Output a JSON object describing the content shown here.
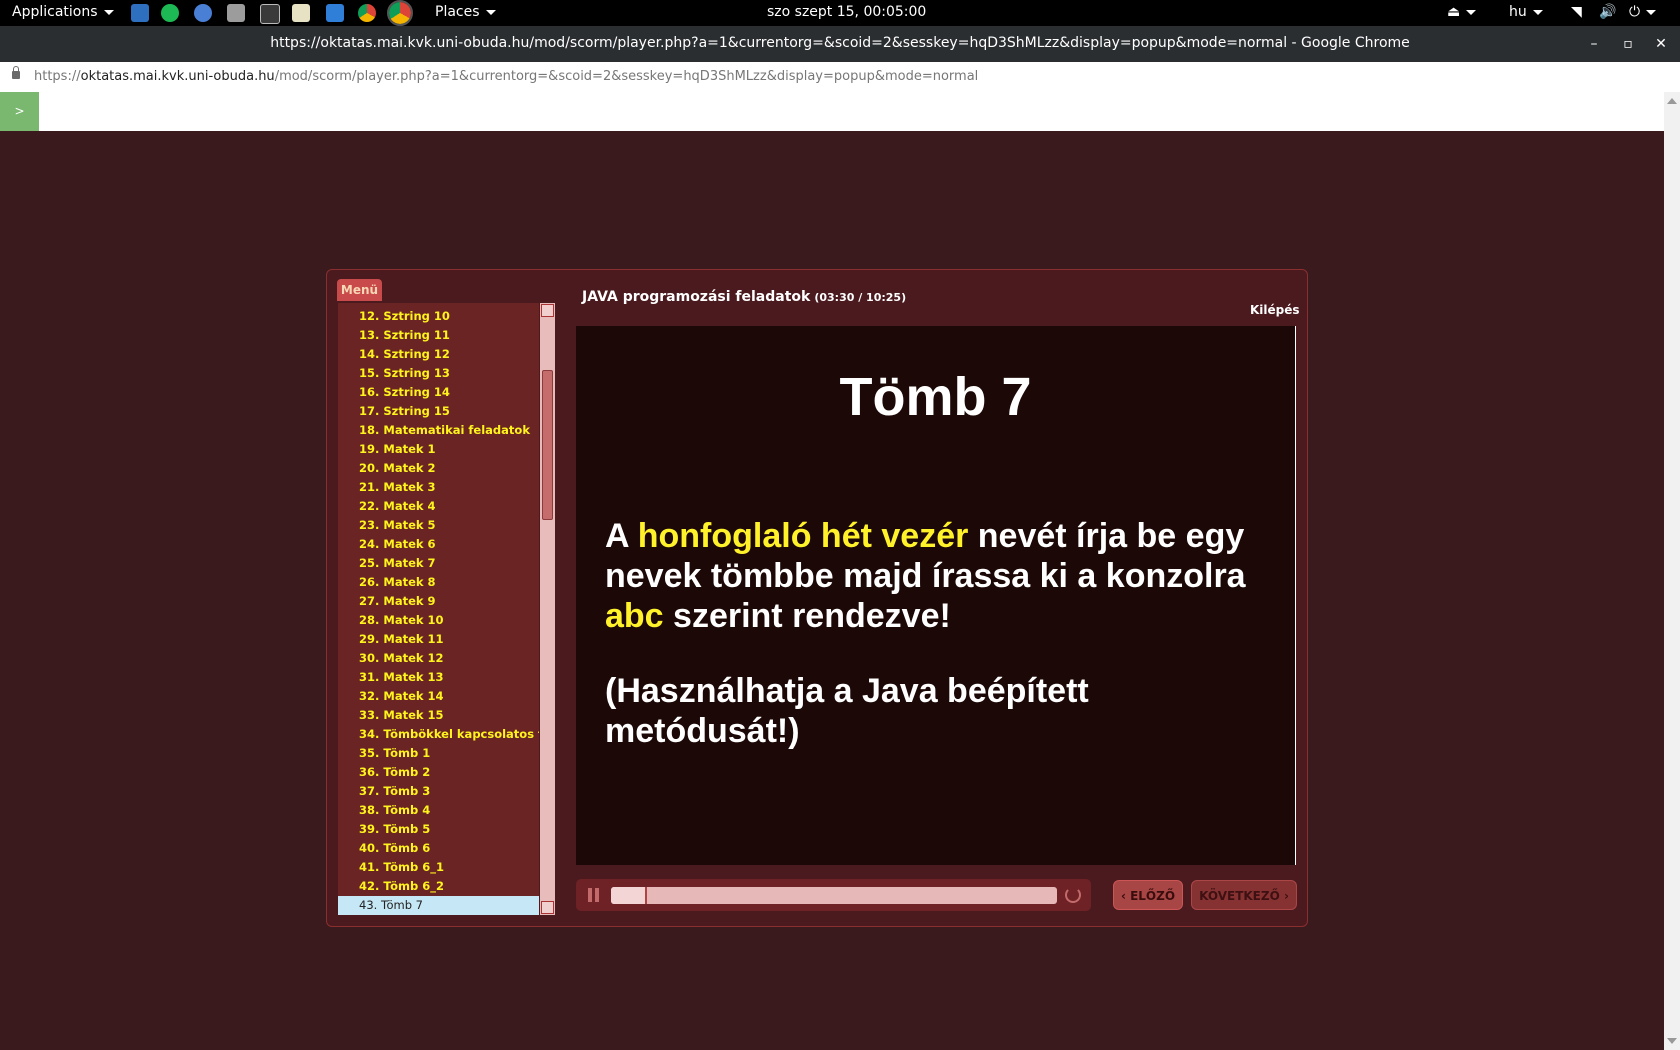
{
  "top_panel": {
    "applications": "Applications",
    "places": "Places",
    "clock": "szo szept 15, 00:05:00",
    "keyboard_layout": "hu",
    "launcher_icons": [
      "files-icon",
      "spotify-icon",
      "chromium-icon",
      "photo-app-icon",
      "terminal-icon",
      "text-editor-icon",
      "system-monitor-icon",
      "chrome-icon",
      "chrome-active-icon"
    ]
  },
  "window": {
    "title": "https://oktatas.mai.kvk.uni-obuda.hu/mod/scorm/player.php?a=1&currentorg=&scoid=2&sesskey=hqD3ShMLzz&display=popup&mode=normal - Google Chrome"
  },
  "address": {
    "scheme": "https://",
    "host": "oktatas.mai.kvk.uni-obuda.hu",
    "path": "/mod/scorm/player.php?a=1&currentorg=&scoid=2&sesskey=hqD3ShMLzz&display=popup&mode=normal"
  },
  "toc_toggle": ">",
  "player": {
    "menu_tab": "Menü",
    "course_title": "JAVA programozási feladatok",
    "course_time": "(03:30 / 10:25)",
    "exit_label": "Kilépés",
    "prev_label": "‹ ELŐZŐ",
    "next_label": "KÖVETKEZŐ ›",
    "progress_fraction": 0.076
  },
  "menu_items": [
    {
      "num": "12.",
      "label": "Sztring 10"
    },
    {
      "num": "13.",
      "label": "Sztring 11"
    },
    {
      "num": "14.",
      "label": "Sztring 12"
    },
    {
      "num": "15.",
      "label": "Sztring 13"
    },
    {
      "num": "16.",
      "label": "Sztring 14"
    },
    {
      "num": "17.",
      "label": "Sztring 15"
    },
    {
      "num": "18.",
      "label": "Matematikai feladatok"
    },
    {
      "num": "19.",
      "label": "Matek 1"
    },
    {
      "num": "20.",
      "label": "Matek 2"
    },
    {
      "num": "21.",
      "label": "Matek 3"
    },
    {
      "num": "22.",
      "label": "Matek 4"
    },
    {
      "num": "23.",
      "label": "Matek 5"
    },
    {
      "num": "24.",
      "label": "Matek 6"
    },
    {
      "num": "25.",
      "label": "Matek 7"
    },
    {
      "num": "26.",
      "label": "Matek 8"
    },
    {
      "num": "27.",
      "label": "Matek 9"
    },
    {
      "num": "28.",
      "label": "Matek 10"
    },
    {
      "num": "29.",
      "label": "Matek 11"
    },
    {
      "num": "30.",
      "label": "Matek 12"
    },
    {
      "num": "31.",
      "label": "Matek 13"
    },
    {
      "num": "32.",
      "label": "Matek 14"
    },
    {
      "num": "33.",
      "label": "Matek 15"
    },
    {
      "num": "34.",
      "label": "Tömbökkel kapcsolatos f..."
    },
    {
      "num": "35.",
      "label": "Tömb 1"
    },
    {
      "num": "36.",
      "label": "Tömb 2"
    },
    {
      "num": "37.",
      "label": "Tömb 3"
    },
    {
      "num": "38.",
      "label": "Tömb 4"
    },
    {
      "num": "39.",
      "label": "Tömb 5"
    },
    {
      "num": "40.",
      "label": "Tömb 6"
    },
    {
      "num": "41.",
      "label": "Tömb 6_1"
    },
    {
      "num": "42.",
      "label": "Tömb 6_2"
    },
    {
      "num": "43.",
      "label": "Tömb 7",
      "selected": true
    }
  ],
  "slide": {
    "title": "Tömb 7",
    "p1_a": "A ",
    "p1_hl1": "honfoglaló hét vezér",
    "p1_b": " nevét  írja be egy nevek tömbbe majd írassa ki a konzolra ",
    "p1_hl2": "abc",
    "p1_c": " szerint rendezve!",
    "p2": "(Használhatja a Java beépített metódusát!)"
  },
  "colors": {
    "page_background": "#3b1a1e",
    "menu_item_text": "#fff41c",
    "slide_highlight": "#fff22a"
  }
}
